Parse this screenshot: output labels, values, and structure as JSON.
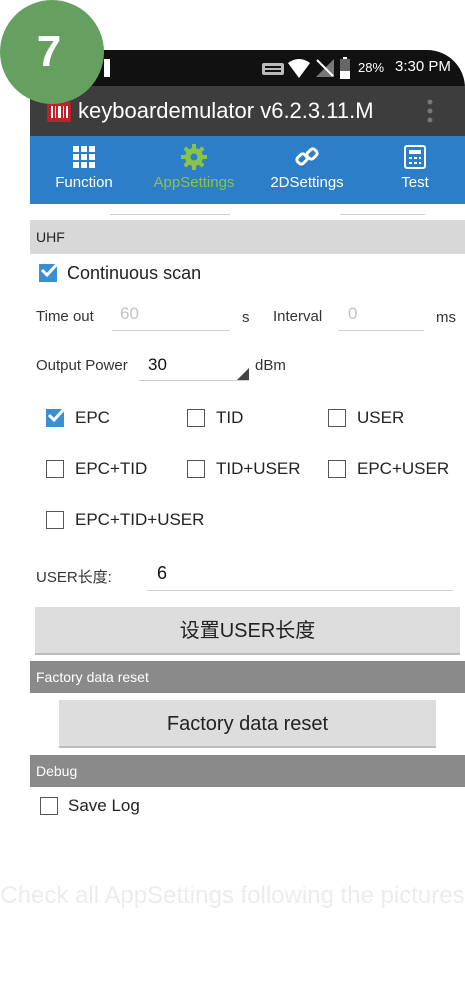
{
  "step": "7",
  "status": {
    "battery": "28%",
    "time": "3:30 PM"
  },
  "app": {
    "title": "keyboardemulator v6.2.3.11.M"
  },
  "tabs": [
    {
      "label": "Function",
      "icon": "grid-icon",
      "active": false
    },
    {
      "label": "AppSettings",
      "icon": "gear-icon",
      "active": true
    },
    {
      "label": "2DSettings",
      "icon": "link-icon",
      "active": false
    },
    {
      "label": "Test",
      "icon": "calculator-icon",
      "active": false
    }
  ],
  "uhf": {
    "header": "UHF",
    "continuous_scan": "Continuous scan",
    "timeout_label": "Time out",
    "timeout_value": "60",
    "timeout_unit": "s",
    "interval_label": "Interval",
    "interval_value": "0",
    "interval_unit": "ms",
    "power_label": "Output Power",
    "power_value": "30",
    "power_unit": "dBm",
    "options": [
      "EPC",
      "TID",
      "USER",
      "EPC+TID",
      "TID+USER",
      "EPC+USER",
      "EPC+TID+USER"
    ],
    "user_len_label": "USER长度:",
    "user_len_value": "6",
    "set_user_len_button": "设置USER长度"
  },
  "factory": {
    "header": "Factory data reset",
    "button": "Factory data reset"
  },
  "debug": {
    "header": "Debug",
    "save_log": "Save Log"
  },
  "caption": "Check all AppSettings following the pictures",
  "colors": {
    "accent_blue": "#2b7ec7",
    "active_tab": "#8bc34a",
    "badge_green": "#66a060"
  }
}
